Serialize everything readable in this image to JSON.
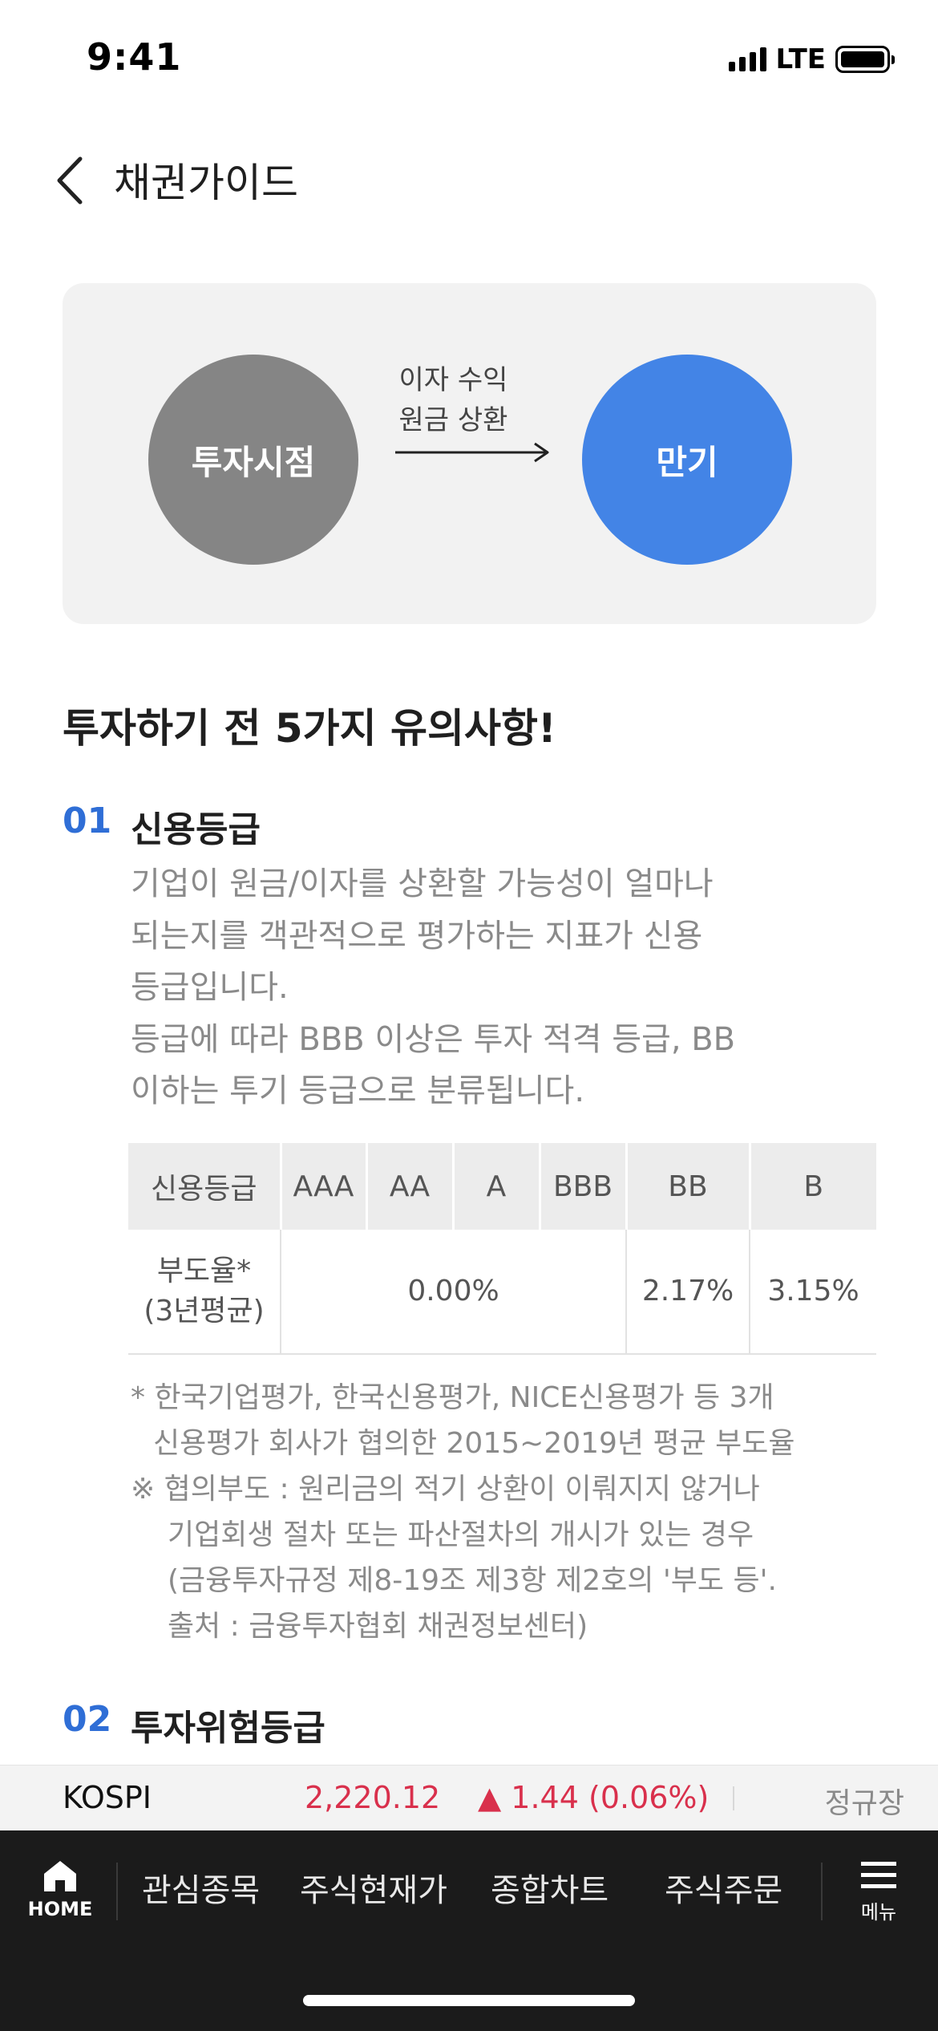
{
  "status": {
    "time": "9:41",
    "network": "LTE"
  },
  "header": {
    "title": "채권가이드"
  },
  "flow": {
    "start_label": "투자시점",
    "end_label": "만기",
    "arrow_line1": "이자 수익",
    "arrow_line2": "원금 상환"
  },
  "section_title": "투자하기 전 5가지 유의사항!",
  "items": [
    {
      "number": "01",
      "title": "신용등급",
      "desc_lines": [
        "기업이 원금/이자를 상환할 가능성이 얼마나",
        "되는지를 객관적으로 평가하는 지표가 신용",
        "등급입니다.",
        "등급에 따라 BBB 이상은 투자 적격 등급, BB",
        "이하는 투기 등급으로 분류됩니다."
      ]
    },
    {
      "number": "02",
      "title": "투자위험등급"
    }
  ],
  "grade_table": {
    "headers": [
      "신용등급",
      "AAA",
      "AA",
      "A",
      "BBB",
      "BB",
      "B"
    ],
    "row_label_line1": "부도율*",
    "row_label_line2": "(3년평균)",
    "investment_grade_rate": "0.00%",
    "bb_rate": "2.17%",
    "b_rate": "3.15%"
  },
  "notes": [
    "* 한국기업평가, 한국신용평가, NICE신용평가 등 3개",
    "신용평가 회사가 협의한 2015~2019년 평균 부도율",
    "※ 협의부도 : 원리금의 적기 상환이 이뤄지지 않거나",
    "기업회생 절차 또는 파산절차의 개시가 있는 경우",
    "(금융투자규정 제8-19조 제3항 제2호의 '부도 등'.",
    "출처 : 금융투자협회 채권정보센터)"
  ],
  "ticker": {
    "name": "KOSPI",
    "value": "2,220.12",
    "change": "▲ 1.44 (0.06%)",
    "session": "정규장",
    "up_color": "#d9304c"
  },
  "bottom_nav": {
    "home_label": "HOME",
    "items": [
      "관심종목",
      "주식현재가",
      "종합차트",
      "주식주문"
    ],
    "menu_label": "메뉴"
  },
  "colors": {
    "accent": "#4384e6",
    "number_blue": "#2f6ed6",
    "start_circle": "#858585"
  }
}
